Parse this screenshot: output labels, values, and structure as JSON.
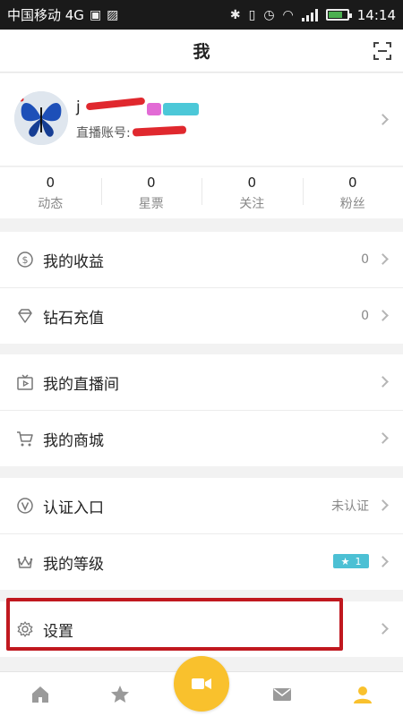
{
  "status_bar": {
    "carrier": "中国移动 4G",
    "network": "4G",
    "time": "14:14"
  },
  "header": {
    "title": "我",
    "scan_icon": "scan-icon"
  },
  "profile": {
    "username_prefix": "j",
    "live_id_label": "直播账号:",
    "colors": {
      "redaction": "#e0282e",
      "badge_pink": "#e26bd5",
      "badge_teal": "#4cc8d8"
    }
  },
  "stats": [
    {
      "value": "0",
      "label": "动态"
    },
    {
      "value": "0",
      "label": "星票"
    },
    {
      "value": "0",
      "label": "关注"
    },
    {
      "value": "0",
      "label": "粉丝"
    }
  ],
  "menu": {
    "earnings": {
      "label": "我的收益",
      "value": "0",
      "icon": "dollar-coin-icon"
    },
    "recharge": {
      "label": "钻石充值",
      "value": "0",
      "icon": "diamond-icon"
    },
    "live_room": {
      "label": "我的直播间",
      "icon": "tv-play-icon"
    },
    "shop": {
      "label": "我的商城",
      "icon": "cart-icon"
    },
    "verify": {
      "label": "认证入口",
      "value": "未认证",
      "icon": "verified-v-icon"
    },
    "level": {
      "label": "我的等级",
      "level": "1",
      "icon": "crown-icon"
    },
    "settings": {
      "label": "设置",
      "icon": "gear-icon"
    }
  },
  "tabbar": {
    "tabs": [
      "home-icon",
      "star-icon",
      "video-camera-icon",
      "mail-icon",
      "person-icon"
    ],
    "active": "person-icon",
    "accent": "#f9c12d"
  },
  "annotation": {
    "highlight_color": "#c0181f"
  }
}
